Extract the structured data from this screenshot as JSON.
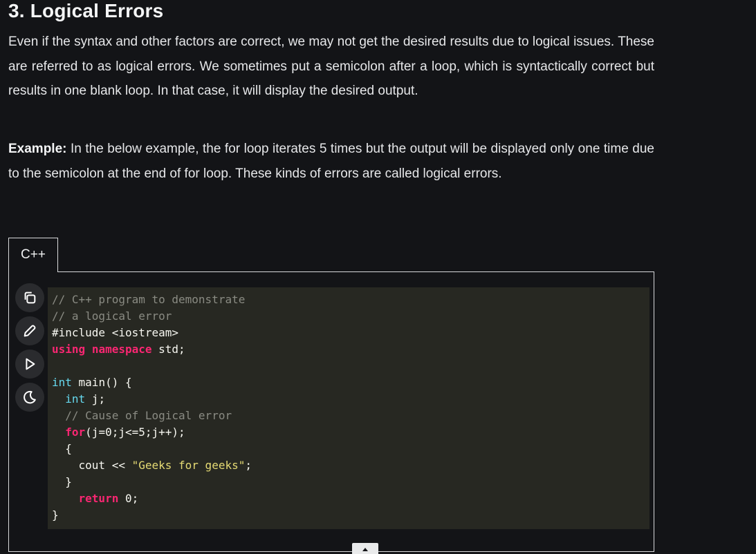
{
  "article": {
    "heading": "3. Logical Errors",
    "paragraph1": "Even if the syntax and other factors are correct, we may not get the desired results due to logical issues. These are referred to as logical errors. We sometimes put a semicolon after a loop, which is syntactically correct but results in one blank loop. In that case, it will display the desired output.",
    "example_label": "Example:",
    "example_text": " In the below example, the for loop iterates 5 times but the output will be displayed only one time due to the semicolon at the end of for loop. These kinds of errors are called logical errors."
  },
  "code_widget": {
    "tab_label": "C++",
    "toolbar": [
      "copy-icon",
      "edit-icon",
      "run-icon",
      "theme-toggle-icon"
    ],
    "lines": [
      [
        {
          "t": "// C++ program to demonstrate",
          "c": "cm"
        }
      ],
      [
        {
          "t": "// a logical error",
          "c": "cm"
        }
      ],
      [
        {
          "t": "#include <iostream>",
          "c": ""
        }
      ],
      [
        {
          "t": "using",
          "c": "kw"
        },
        {
          "t": " ",
          "c": ""
        },
        {
          "t": "namespace",
          "c": "kw"
        },
        {
          "t": " std;",
          "c": ""
        }
      ],
      [],
      [
        {
          "t": "int",
          "c": "ty"
        },
        {
          "t": " main() {",
          "c": ""
        }
      ],
      [
        {
          "t": "  ",
          "c": ""
        },
        {
          "t": "int",
          "c": "ty"
        },
        {
          "t": " j;",
          "c": ""
        }
      ],
      [
        {
          "t": "  ",
          "c": ""
        },
        {
          "t": "// Cause of Logical error",
          "c": "cm"
        }
      ],
      [
        {
          "t": "  ",
          "c": ""
        },
        {
          "t": "for",
          "c": "kw"
        },
        {
          "t": "(j=0;j<=5;j++);",
          "c": ""
        }
      ],
      [
        {
          "t": "  {",
          "c": ""
        }
      ],
      [
        {
          "t": "    cout << ",
          "c": ""
        },
        {
          "t": "\"Geeks for geeks\"",
          "c": "st"
        },
        {
          "t": ";",
          "c": ""
        }
      ],
      [
        {
          "t": "  }",
          "c": ""
        }
      ],
      [
        {
          "t": "    ",
          "c": ""
        },
        {
          "t": "return",
          "c": "kw"
        },
        {
          "t": " 0;",
          "c": ""
        }
      ],
      [
        {
          "t": "}",
          "c": ""
        }
      ]
    ]
  },
  "colors": {
    "background": "#131417",
    "code_background": "#272822",
    "keyword": "#f92672",
    "type": "#66d9ef",
    "string": "#e6db74",
    "comment": "#8a8b83"
  }
}
